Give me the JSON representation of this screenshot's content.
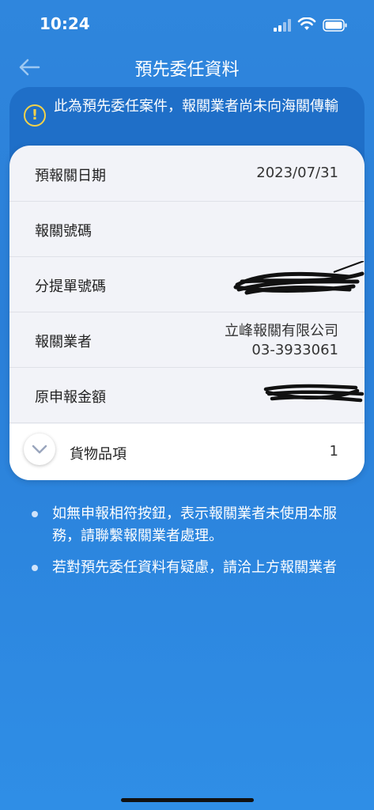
{
  "status_bar": {
    "time": "10:24"
  },
  "header": {
    "title": "預先委任資料"
  },
  "notice": {
    "text": "此為預先委任案件，報關業者尚未向海關傳輸"
  },
  "details": {
    "rows": [
      {
        "label": "預報關日期",
        "value": "2023/07/31"
      },
      {
        "label": "報關號碼",
        "value": ""
      },
      {
        "label": "分提單號碼",
        "value": ""
      },
      {
        "label": "報關業者",
        "value_line1": "立峰報關有限公司",
        "value_line2": "03-3933061"
      },
      {
        "label": "原申報金額",
        "value": ""
      }
    ],
    "goods": {
      "label": "貨物品項",
      "count": "1"
    }
  },
  "bullets": [
    "如無申報相符按鈕，表示報關業者未使用本服務，請聯繫報關業者處理。",
    "若對預先委任資料有疑慮，請洽上方報關業者"
  ],
  "colors": {
    "background": "#2a7fd8",
    "notice_bg": "#1f6fc8",
    "warning": "#f2d24a",
    "card_bg": "#f2f3f8"
  }
}
